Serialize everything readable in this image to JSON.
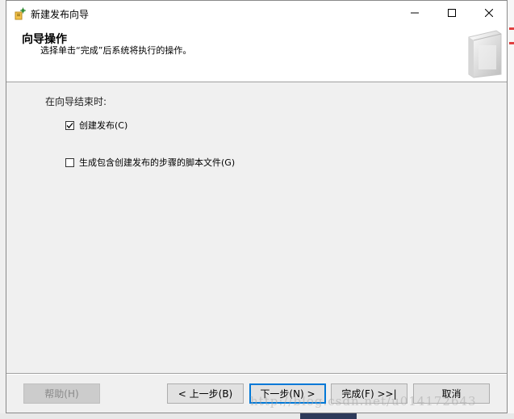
{
  "window": {
    "title": "新建发布向导",
    "controls": {
      "minimize": "—",
      "maximize": "☐",
      "close": "✕"
    }
  },
  "header": {
    "title": "向导操作",
    "subtitle": "选择单击“完成”后系统将执行的操作。"
  },
  "main": {
    "section_label": "在向导结束时:",
    "options": [
      {
        "label": "创建发布(C)",
        "checked": true
      },
      {
        "label": "生成包含创建发布的步骤的脚本文件(G)",
        "checked": false
      }
    ]
  },
  "buttons": {
    "help": "帮助(H)",
    "back": "< 上一步(B)",
    "next": "下一步(N) >",
    "finish": "完成(F) >>|",
    "cancel": "取消"
  },
  "watermark": "http://blog.csdn.net/u014172643",
  "colors": {
    "accent": "#0078d7",
    "window_bg": "#f0f0f0"
  }
}
